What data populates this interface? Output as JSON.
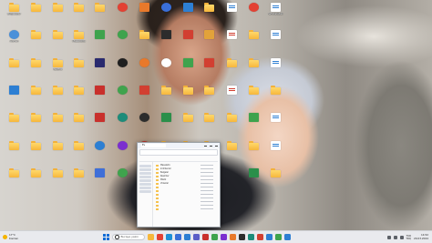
{
  "desktop": {
    "icons": [
      {
        "col": 0,
        "row": 0,
        "kind": "folder",
        "color": "#f6b73c",
        "icon": "folder-icon",
        "label": "Bilgisayar"
      },
      {
        "col": 1,
        "row": 0,
        "kind": "folder",
        "color": "#f6b73c",
        "icon": "folder-icon",
        "label": ""
      },
      {
        "col": 2,
        "row": 0,
        "kind": "folder",
        "color": "#f6b73c",
        "icon": "folder-icon",
        "label": ""
      },
      {
        "col": 3,
        "row": 0,
        "kind": "folder",
        "color": "#f6b73c",
        "icon": "folder-icon",
        "label": ""
      },
      {
        "col": 4,
        "row": 0,
        "kind": "folder",
        "color": "#f6b73c",
        "icon": "folder-icon",
        "label": ""
      },
      {
        "col": 5,
        "row": 0,
        "kind": "round",
        "color": "#e34133",
        "icon": "chrome-icon",
        "label": ""
      },
      {
        "col": 6,
        "row": 0,
        "kind": "app",
        "color": "#e8792b",
        "icon": "app-icon",
        "label": ""
      },
      {
        "col": 7,
        "row": 0,
        "kind": "round",
        "color": "#3a6fd8",
        "icon": "settings-icon",
        "label": ""
      },
      {
        "col": 8,
        "row": 0,
        "kind": "app",
        "color": "#2d7fd3",
        "icon": "vscode-icon",
        "label": ""
      },
      {
        "col": 9,
        "row": 0,
        "kind": "folder",
        "color": "#f6b73c",
        "icon": "folder-icon",
        "label": ""
      },
      {
        "col": 10,
        "row": 0,
        "kind": "doc",
        "color": "#ffffff",
        "icon": "document-icon",
        "label": ""
      },
      {
        "col": 11,
        "row": 0,
        "kind": "round",
        "color": "#e34133",
        "icon": "chrome-icon",
        "label": ""
      },
      {
        "col": 12,
        "row": 0,
        "kind": "doc",
        "color": "#ffffff",
        "icon": "document-icon",
        "label": "Whitelabel"
      },
      {
        "col": 0,
        "row": 1,
        "kind": "round",
        "color": "#4a90d9",
        "icon": "user-icon",
        "label": "Admin"
      },
      {
        "col": 1,
        "row": 1,
        "kind": "folder",
        "color": "#f6b73c",
        "icon": "folder-icon",
        "label": ""
      },
      {
        "col": 2,
        "row": 1,
        "kind": "folder",
        "color": "#f6b73c",
        "icon": "folder-icon",
        "label": ""
      },
      {
        "col": 3,
        "row": 1,
        "kind": "folder",
        "color": "#f6b73c",
        "icon": "folder-icon",
        "label": "Masaüstü"
      },
      {
        "col": 4,
        "row": 1,
        "kind": "app",
        "color": "#3fa34d",
        "icon": "app-icon",
        "label": ""
      },
      {
        "col": 5,
        "row": 1,
        "kind": "round",
        "color": "#3fa34d",
        "icon": "app-icon",
        "label": ""
      },
      {
        "col": 6,
        "row": 1,
        "kind": "folder",
        "color": "#f6b73c",
        "icon": "folder-icon",
        "label": ""
      },
      {
        "col": 7,
        "row": 1,
        "kind": "app",
        "color": "#2c2c2c",
        "icon": "app-icon",
        "label": ""
      },
      {
        "col": 8,
        "row": 1,
        "kind": "app",
        "color": "#d23f31",
        "icon": "app-icon",
        "label": ""
      },
      {
        "col": 9,
        "row": 1,
        "kind": "app",
        "color": "#e2a23a",
        "icon": "app-icon",
        "label": ""
      },
      {
        "col": 10,
        "row": 1,
        "kind": "doc",
        "color": "#ffffff",
        "icon": "pdf-icon",
        "label": ""
      },
      {
        "col": 11,
        "row": 1,
        "kind": "folder",
        "color": "#f6b73c",
        "icon": "folder-icon",
        "label": ""
      },
      {
        "col": 12,
        "row": 1,
        "kind": "doc",
        "color": "#ffffff",
        "icon": "document-icon",
        "label": ""
      },
      {
        "col": 0,
        "row": 2,
        "kind": "folder",
        "color": "#f6b73c",
        "icon": "folder-icon",
        "label": ""
      },
      {
        "col": 1,
        "row": 2,
        "kind": "folder",
        "color": "#f6b73c",
        "icon": "folder-icon",
        "label": ""
      },
      {
        "col": 2,
        "row": 2,
        "kind": "folder",
        "color": "#f6b73c",
        "icon": "folder-icon",
        "label": "Netflix"
      },
      {
        "col": 3,
        "row": 2,
        "kind": "folder",
        "color": "#f6b73c",
        "icon": "folder-icon",
        "label": ""
      },
      {
        "col": 4,
        "row": 2,
        "kind": "app",
        "color": "#2a2a6e",
        "icon": "app-icon",
        "label": ""
      },
      {
        "col": 5,
        "row": 2,
        "kind": "round",
        "color": "#1f1f1f",
        "icon": "app-icon",
        "label": ""
      },
      {
        "col": 6,
        "row": 2,
        "kind": "round",
        "color": "#e8792b",
        "icon": "app-icon",
        "label": ""
      },
      {
        "col": 7,
        "row": 2,
        "kind": "round",
        "color": "#ffffff",
        "icon": "app-icon",
        "label": ""
      },
      {
        "col": 8,
        "row": 2,
        "kind": "app",
        "color": "#3fa34d",
        "icon": "app-icon",
        "label": ""
      },
      {
        "col": 9,
        "row": 2,
        "kind": "app",
        "color": "#d23f31",
        "icon": "app-icon",
        "label": ""
      },
      {
        "col": 10,
        "row": 2,
        "kind": "folder",
        "color": "#f6b73c",
        "icon": "folder-icon",
        "label": ""
      },
      {
        "col": 11,
        "row": 2,
        "kind": "folder",
        "color": "#f6b73c",
        "icon": "folder-icon",
        "label": ""
      },
      {
        "col": 12,
        "row": 2,
        "kind": "doc",
        "color": "#ffffff",
        "icon": "document-icon",
        "label": ""
      },
      {
        "col": 0,
        "row": 3,
        "kind": "app",
        "color": "#2d7fd3",
        "icon": "app-icon",
        "label": ""
      },
      {
        "col": 1,
        "row": 3,
        "kind": "folder",
        "color": "#f6b73c",
        "icon": "folder-icon",
        "label": ""
      },
      {
        "col": 2,
        "row": 3,
        "kind": "folder",
        "color": "#f6b73c",
        "icon": "folder-icon",
        "label": ""
      },
      {
        "col": 3,
        "row": 3,
        "kind": "folder",
        "color": "#f6b73c",
        "icon": "folder-icon",
        "label": ""
      },
      {
        "col": 4,
        "row": 3,
        "kind": "app",
        "color": "#c9302c",
        "icon": "app-icon",
        "label": ""
      },
      {
        "col": 5,
        "row": 3,
        "kind": "round",
        "color": "#3fa34d",
        "icon": "app-icon",
        "label": ""
      },
      {
        "col": 6,
        "row": 3,
        "kind": "app",
        "color": "#d23f31",
        "icon": "app-icon",
        "label": ""
      },
      {
        "col": 7,
        "row": 3,
        "kind": "folder",
        "color": "#f6b73c",
        "icon": "folder-icon",
        "label": ""
      },
      {
        "col": 8,
        "row": 3,
        "kind": "folder",
        "color": "#f6b73c",
        "icon": "folder-icon",
        "label": ""
      },
      {
        "col": 9,
        "row": 3,
        "kind": "folder",
        "color": "#f6b73c",
        "icon": "folder-icon",
        "label": ""
      },
      {
        "col": 10,
        "row": 3,
        "kind": "doc",
        "color": "#ffffff",
        "icon": "pdf-icon",
        "label": ""
      },
      {
        "col": 11,
        "row": 3,
        "kind": "folder",
        "color": "#f6b73c",
        "icon": "folder-icon",
        "label": ""
      },
      {
        "col": 12,
        "row": 3,
        "kind": "folder",
        "color": "#f6b73c",
        "icon": "folder-icon",
        "label": ""
      },
      {
        "col": 0,
        "row": 4,
        "kind": "folder",
        "color": "#f6b73c",
        "icon": "folder-icon",
        "label": ""
      },
      {
        "col": 1,
        "row": 4,
        "kind": "folder",
        "color": "#f6b73c",
        "icon": "folder-icon",
        "label": ""
      },
      {
        "col": 2,
        "row": 4,
        "kind": "folder",
        "color": "#f6b73c",
        "icon": "folder-icon",
        "label": ""
      },
      {
        "col": 3,
        "row": 4,
        "kind": "folder",
        "color": "#f6b73c",
        "icon": "folder-icon",
        "label": ""
      },
      {
        "col": 4,
        "row": 4,
        "kind": "app",
        "color": "#c9302c",
        "icon": "app-icon",
        "label": ""
      },
      {
        "col": 5,
        "row": 4,
        "kind": "round",
        "color": "#1c8c7a",
        "icon": "app-icon",
        "label": ""
      },
      {
        "col": 6,
        "row": 4,
        "kind": "round",
        "color": "#2c2c2c",
        "icon": "app-icon",
        "label": ""
      },
      {
        "col": 7,
        "row": 4,
        "kind": "app",
        "color": "#2a8f4a",
        "icon": "app-icon",
        "label": ""
      },
      {
        "col": 8,
        "row": 4,
        "kind": "folder",
        "color": "#f6b73c",
        "icon": "folder-icon",
        "label": ""
      },
      {
        "col": 9,
        "row": 4,
        "kind": "folder",
        "color": "#f6b73c",
        "icon": "folder-icon",
        "label": ""
      },
      {
        "col": 10,
        "row": 4,
        "kind": "folder",
        "color": "#f6b73c",
        "icon": "folder-icon",
        "label": ""
      },
      {
        "col": 11,
        "row": 4,
        "kind": "app",
        "color": "#3fa34d",
        "icon": "app-icon",
        "label": ""
      },
      {
        "col": 12,
        "row": 4,
        "kind": "doc",
        "color": "#ffffff",
        "icon": "document-icon",
        "label": ""
      },
      {
        "col": 0,
        "row": 5,
        "kind": "folder",
        "color": "#f6b73c",
        "icon": "folder-icon",
        "label": ""
      },
      {
        "col": 1,
        "row": 5,
        "kind": "folder",
        "color": "#f6b73c",
        "icon": "folder-icon",
        "label": ""
      },
      {
        "col": 2,
        "row": 5,
        "kind": "folder",
        "color": "#f6b73c",
        "icon": "folder-icon",
        "label": ""
      },
      {
        "col": 3,
        "row": 5,
        "kind": "folder",
        "color": "#f6b73c",
        "icon": "folder-icon",
        "label": ""
      },
      {
        "col": 4,
        "row": 5,
        "kind": "round",
        "color": "#2d7fd3",
        "icon": "app-icon",
        "label": ""
      },
      {
        "col": 5,
        "row": 5,
        "kind": "round",
        "color": "#7b2fd0",
        "icon": "app-icon",
        "label": ""
      },
      {
        "col": 6,
        "row": 5,
        "kind": "round",
        "color": "#c9302c",
        "icon": "app-icon",
        "label": ""
      },
      {
        "col": 7,
        "row": 5,
        "kind": "folder",
        "color": "#f6b73c",
        "icon": "folder-icon",
        "label": ""
      },
      {
        "col": 8,
        "row": 5,
        "kind": "folder",
        "color": "#f6b73c",
        "icon": "folder-icon",
        "label": ""
      },
      {
        "col": 9,
        "row": 5,
        "kind": "folder",
        "color": "#f6b73c",
        "icon": "folder-icon",
        "label": ""
      },
      {
        "col": 10,
        "row": 5,
        "kind": "folder",
        "color": "#f6b73c",
        "icon": "folder-icon",
        "label": ""
      },
      {
        "col": 11,
        "row": 5,
        "kind": "folder",
        "color": "#f6b73c",
        "icon": "folder-icon",
        "label": ""
      },
      {
        "col": 12,
        "row": 5,
        "kind": "doc",
        "color": "#ffffff",
        "icon": "document-icon",
        "label": ""
      },
      {
        "col": 0,
        "row": 6,
        "kind": "folder",
        "color": "#f6b73c",
        "icon": "folder-icon",
        "label": ""
      },
      {
        "col": 1,
        "row": 6,
        "kind": "folder",
        "color": "#f6b73c",
        "icon": "folder-icon",
        "label": ""
      },
      {
        "col": 2,
        "row": 6,
        "kind": "folder",
        "color": "#f6b73c",
        "icon": "folder-icon",
        "label": ""
      },
      {
        "col": 3,
        "row": 6,
        "kind": "folder",
        "color": "#f6b73c",
        "icon": "folder-icon",
        "label": ""
      },
      {
        "col": 4,
        "row": 6,
        "kind": "app",
        "color": "#3f6fd8",
        "icon": "app-icon",
        "label": ""
      },
      {
        "col": 5,
        "row": 6,
        "kind": "round",
        "color": "#3fa34d",
        "icon": "app-icon",
        "label": ""
      },
      {
        "col": 11,
        "row": 6,
        "kind": "app",
        "color": "#2a8f4a",
        "icon": "app-icon",
        "label": ""
      },
      {
        "col": 12,
        "row": 6,
        "kind": "folder",
        "color": "#f6b73c",
        "icon": "folder-icon",
        "label": ""
      }
    ]
  },
  "explorer": {
    "tab_title": "Ev",
    "files": [
      {
        "name": "Masaüstü"
      },
      {
        "name": "İndirilenler"
      },
      {
        "name": "Belgeler"
      },
      {
        "name": "Resimler"
      },
      {
        "name": "Müzik"
      },
      {
        "name": "Videolar"
      },
      {
        "name": ""
      },
      {
        "name": ""
      },
      {
        "name": ""
      },
      {
        "name": ""
      },
      {
        "name": ""
      },
      {
        "name": ""
      },
      {
        "name": ""
      }
    ]
  },
  "taskbar": {
    "weather": {
      "temp": "17°C",
      "desc": "Kısmen"
    },
    "search_placeholder": "Buraya yazın",
    "apps": [
      {
        "icon": "file-explorer-icon",
        "color": "#f6b73c"
      },
      {
        "icon": "chrome-icon",
        "color": "#e34133"
      },
      {
        "icon": "edge-icon",
        "color": "#1e90d6"
      },
      {
        "icon": "store-icon",
        "color": "#3a6fd8"
      },
      {
        "icon": "mail-icon",
        "color": "#2d7fd3"
      },
      {
        "icon": "teams-icon",
        "color": "#5b5fc7"
      },
      {
        "icon": "app-icon",
        "color": "#c9302c"
      },
      {
        "icon": "app-icon",
        "color": "#3fa34d"
      },
      {
        "icon": "app-icon",
        "color": "#7b2fd0"
      },
      {
        "icon": "app-icon",
        "color": "#e8792b"
      },
      {
        "icon": "app-icon",
        "color": "#2c2c2c"
      },
      {
        "icon": "app-icon",
        "color": "#1c8c7a"
      },
      {
        "icon": "app-icon",
        "color": "#d23f31"
      },
      {
        "icon": "app-icon",
        "color": "#2d7fd3"
      },
      {
        "icon": "app-icon",
        "color": "#3fa34d"
      },
      {
        "icon": "vscode-icon",
        "color": "#2d7fd3"
      }
    ],
    "tray": {
      "lang_top": "TUR",
      "lang_bottom": "TRQ",
      "time": "14:52",
      "date": "20.03.2024"
    }
  }
}
